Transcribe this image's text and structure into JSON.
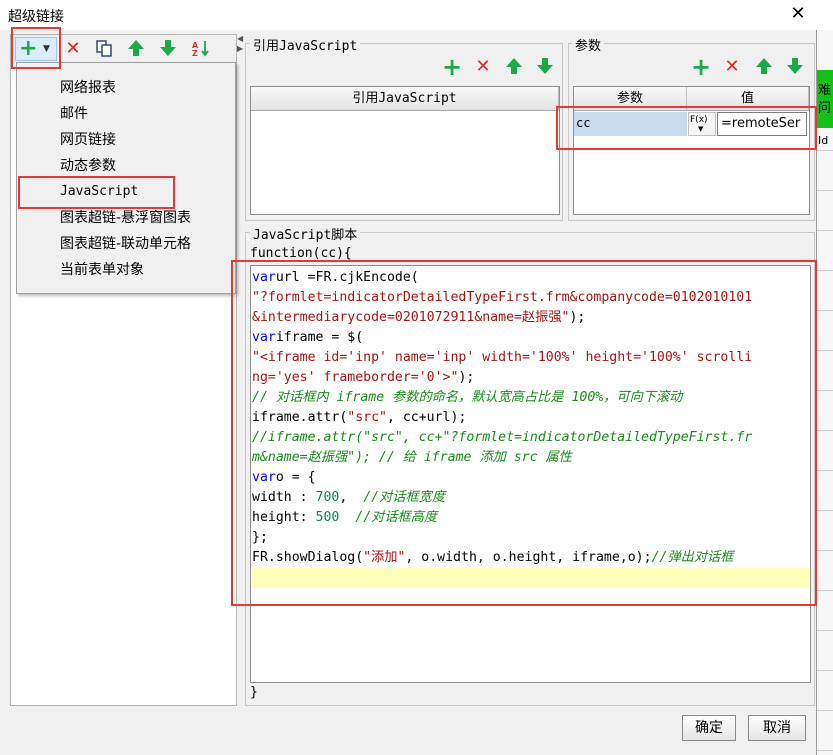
{
  "window": {
    "title": "超级链接",
    "close_glyph": "✕"
  },
  "background": {
    "glyph_top": "难",
    "glyph_mid": "问",
    "glyph_low": "Id"
  },
  "left_toolbar": {
    "icons": [
      "add-dropdown-icon",
      "delete-icon",
      "copy-icon",
      "move-up-icon",
      "move-down-icon",
      "sort-icon"
    ]
  },
  "link_type_menu": {
    "items": [
      "网络报表",
      "邮件",
      "网页链接",
      "动态参数",
      "JavaScript",
      "图表超链-悬浮窗图表",
      "图表超链-联动单元格",
      "当前表单对象"
    ],
    "selected": "JavaScript"
  },
  "ref_js": {
    "group_label": "引用JavaScript",
    "column_header": "引用JavaScript"
  },
  "params": {
    "group_label": "参数",
    "headers": [
      "参数",
      "值"
    ],
    "rows": [
      {
        "name": "cc",
        "formula_button": "F(x)",
        "value": "=remoteSer"
      }
    ]
  },
  "script": {
    "group_label": "JavaScript脚本",
    "header_line": "function(cc){",
    "footer_line": "}",
    "lines": [
      [
        [
          "kw",
          "var"
        ],
        [
          "",
          "url =FR.cjkEncode("
        ]
      ],
      [
        [
          "str",
          "\"?formlet=indicatorDetailedTypeFirst.frm&companycode=0102010101"
        ]
      ],
      [
        [
          "str",
          "&intermediarycode=0201072911&name=赵振强\""
        ],
        [
          "",
          ");"
        ]
      ],
      [
        [
          "kw",
          "var"
        ],
        [
          "",
          "iframe = $("
        ]
      ],
      [
        [
          "str",
          "\"<iframe id='inp' name='inp' width='100%' height='100%' scrolli"
        ]
      ],
      [
        [
          "str",
          "ng='yes' frameborder='0'>\""
        ],
        [
          "",
          ");"
        ]
      ],
      [
        [
          "cm",
          "// 对话框内 iframe 参数的命名，默认宽高占比是 100%，可向下滚动"
        ]
      ],
      [
        [
          "",
          "iframe.attr("
        ],
        [
          "str",
          "\"src\""
        ],
        [
          "",
          ", cc+url);"
        ]
      ],
      [
        [
          "cm",
          "//iframe.attr(\"src\", cc+\"?formlet=indicatorDetailedTypeFirst.fr"
        ]
      ],
      [
        [
          "cm",
          "m&name=赵振强\"); // 给 iframe 添加 src 属性"
        ]
      ],
      [
        [
          "kw",
          "var"
        ],
        [
          "",
          "o = {"
        ]
      ],
      [
        [
          "",
          "width : "
        ],
        [
          "num",
          "700"
        ],
        [
          "",
          ",  "
        ],
        [
          "cm",
          "//对话框宽度"
        ]
      ],
      [
        [
          "",
          "height: "
        ],
        [
          "num",
          "500"
        ],
        [
          "",
          "  "
        ],
        [
          "cm",
          "//对话框高度"
        ]
      ],
      [
        [
          "",
          "};"
        ]
      ],
      [
        [
          "",
          "FR.showDialog("
        ],
        [
          "str",
          "\"添加\""
        ],
        [
          "",
          ", o.width, o.height, iframe,o);"
        ],
        [
          "cm",
          "//弹出对话框"
        ]
      ]
    ]
  },
  "footer": {
    "ok_label": "确定",
    "cancel_label": "取消"
  }
}
